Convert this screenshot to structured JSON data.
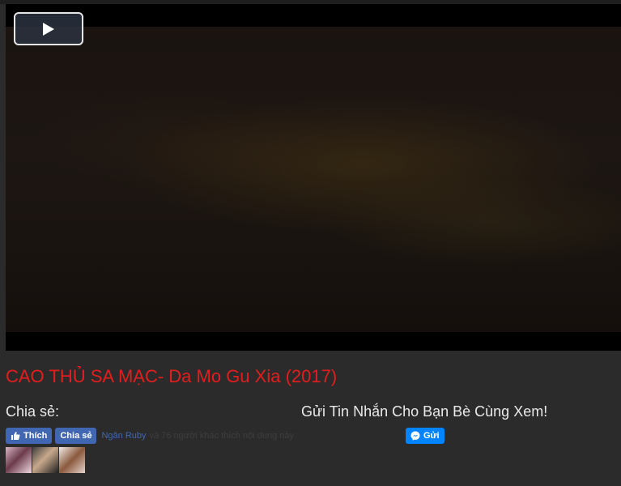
{
  "player": {
    "play_icon": "play-icon"
  },
  "movie": {
    "title": "CAO THỦ SA MẠC- Da Mo Gu Xia (2017)"
  },
  "share": {
    "label": "Chia sẻ:",
    "like_label": "Thích",
    "share_label": "Chia sẻ",
    "friend_name": "Ngân Ruby",
    "friend_text": "và 76 người khác thích nội dung này",
    "avatars": [
      "avatar-1",
      "avatar-2",
      "avatar-3"
    ]
  },
  "message": {
    "label": "Gửi Tin Nhắn Cho Bạn Bè Cùng Xem!",
    "send_label": "Gửi"
  },
  "colors": {
    "title": "#e41d1d",
    "facebook": "#4267b2",
    "messenger": "#0084ff",
    "background": "#2b2b2b"
  }
}
